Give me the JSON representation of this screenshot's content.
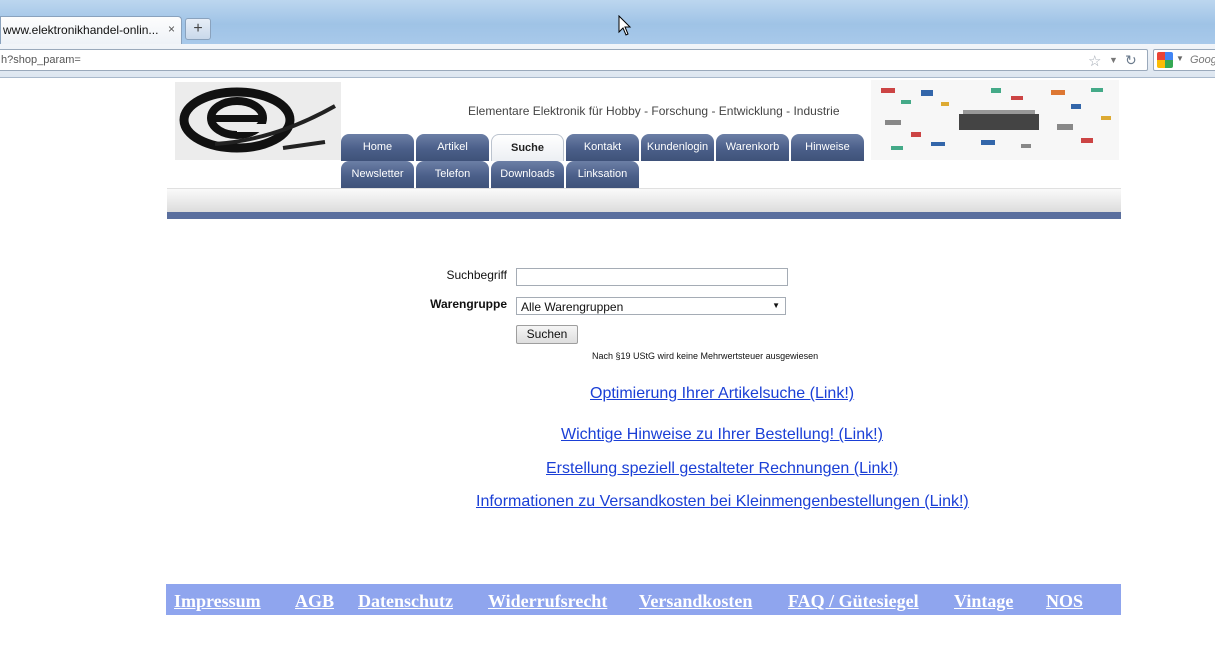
{
  "browser": {
    "tab_title": "www.elektronikhandel-onlin...",
    "tab_close": "×",
    "new_tab": "+",
    "url": "h?shop_param=",
    "search_placeholder": "Goog"
  },
  "header": {
    "tagline": "Elementare Elektronik für Hobby - Forschung - Entwicklung - Industrie"
  },
  "nav": {
    "home": "Home",
    "artikel": "Artikel",
    "suche": "Suche",
    "kontakt": "Kontakt",
    "kundenlogin": "Kundenlogin",
    "warenkorb": "Warenkorb",
    "hinweise": "Hinweise",
    "newsletter": "Newsletter",
    "telefon": "Telefon",
    "downloads": "Downloads",
    "linksation": "Linksation"
  },
  "search_form": {
    "term_label": "Suchbegriff",
    "term_value": "",
    "group_label": "Warengruppe",
    "group_value": "Alle Warengruppen",
    "submit": "Suchen",
    "tax_note": "Nach §19 UStG wird keine Mehrwertsteuer ausgewiesen"
  },
  "links": {
    "optimize": "Optimierung Ihrer Artikelsuche (Link!)",
    "order_notes": "Wichtige Hinweise zu Ihrer Bestellung! (Link!)",
    "invoices": "Erstellung speziell gestalteter Rechnungen (Link!)",
    "shipping": "Informationen zu Versandkosten bei Kleinmengenbestellungen (Link!)"
  },
  "footer": {
    "impressum": "Impressum",
    "agb": "AGB",
    "datenschutz": "Datenschutz",
    "widerruf": "Widerrufsrecht",
    "versand": "Versandkosten",
    "faq": "FAQ / Gütesiegel",
    "vintage": "Vintage",
    "nos": "NOS"
  }
}
